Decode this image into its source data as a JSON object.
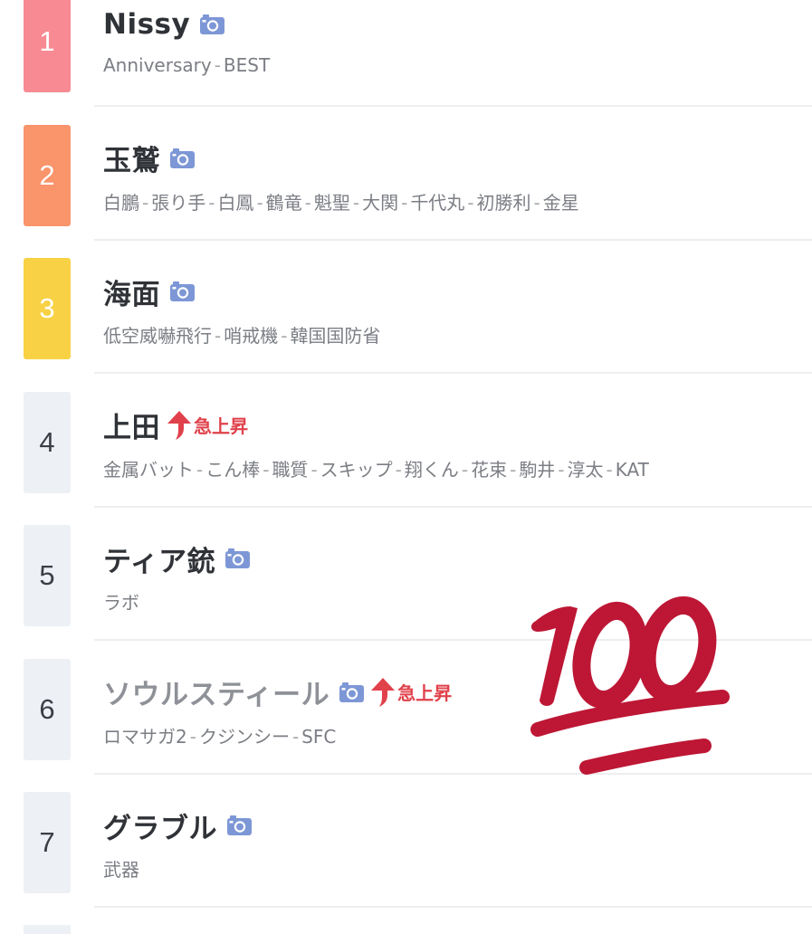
{
  "colors": {
    "rank1": "#f78a92",
    "rank2": "#f9946b",
    "rank3": "#f8d145",
    "rank_plain": "#edf0f4",
    "camera_icon": "#7d97d6",
    "surge_red": "#e0414b",
    "emoji_red": "#bd1735"
  },
  "ranking": [
    {
      "rank": "1",
      "title": "Nissy",
      "has_camera": true,
      "surge": false,
      "tags": [
        "Anniversary",
        "BEST"
      ]
    },
    {
      "rank": "2",
      "title": "玉鷲",
      "has_camera": true,
      "surge": false,
      "tags": [
        "白鵬",
        "張り手",
        "白鳳",
        "鶴竜",
        "魁聖",
        "大関",
        "千代丸",
        "初勝利",
        "金星"
      ]
    },
    {
      "rank": "3",
      "title": "海面",
      "has_camera": true,
      "surge": false,
      "tags": [
        "低空威嚇飛行",
        "哨戒機",
        "韓国国防省"
      ]
    },
    {
      "rank": "4",
      "title": "上田",
      "has_camera": false,
      "surge": true,
      "surge_label": "急上昇",
      "tags": [
        "金属バット",
        "こん棒",
        "職質",
        "スキップ",
        "翔くん",
        "花束",
        "駒井",
        "淳太",
        "KAT"
      ]
    },
    {
      "rank": "5",
      "title": "ティア銃",
      "has_camera": true,
      "surge": false,
      "tags": [
        "ラボ"
      ]
    },
    {
      "rank": "6",
      "title": "ソウルスティール",
      "has_camera": true,
      "surge": true,
      "surge_label": "急上昇",
      "tags": [
        "ロマサガ2",
        "クジンシー",
        "SFC"
      ]
    },
    {
      "rank": "7",
      "title": "グラブル",
      "has_camera": true,
      "surge": false,
      "tags": [
        "武器"
      ]
    }
  ],
  "tag_separator": "-",
  "overlay": {
    "icon": "hundred-points-icon",
    "text": "100"
  }
}
